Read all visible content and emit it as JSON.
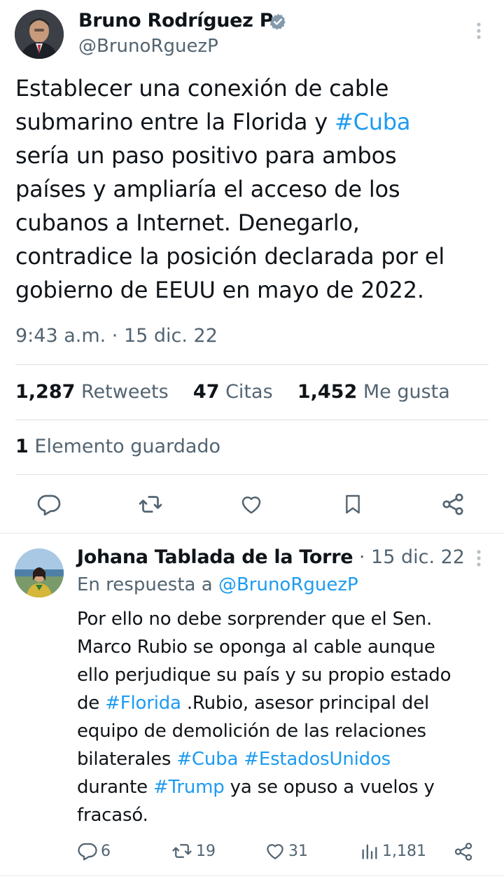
{
  "tweet": {
    "author_name": "Bruno Rodríguez P",
    "author_handle": "@BrunoRguezP",
    "verified_icon": "verified-badge-icon",
    "text_parts": [
      {
        "line": "Establecer una conexión de cable"
      },
      {
        "line_a": "submarino entre la Florida y ",
        "hashtag": "#Cuba"
      },
      {
        "line": "sería un paso positivo para ambos"
      },
      {
        "line": "países y ampliaría el acceso de los"
      },
      {
        "line": "cubanos a Internet. Denegarlo,"
      },
      {
        "line": "contradice la posición declarada por el"
      },
      {
        "line": "gobierno de EEUU en mayo de 2022."
      }
    ],
    "timestamp": "9:43 a.m. · 15 dic. 22",
    "retweets_count": "1,287",
    "retweets_label": "Retweets",
    "quotes_count": "47",
    "quotes_label": "Citas",
    "likes_count": "1,452",
    "likes_label": "Me gusta",
    "bookmarks_count": "1",
    "bookmarks_label": "Elemento guardado"
  },
  "reply": {
    "author_name": "Johana Tablada de la Torre",
    "sep": "·",
    "date": "15 dic. 22",
    "in_reply_prefix": "En respuesta a ",
    "in_reply_handle": "@BrunoRguezP",
    "lines": [
      "Por ello no debe sorprender que el Sen.",
      "Marco Rubio se oponga al cable aunque",
      "ello perjudique su país y su propio estado"
    ],
    "line4_a": "de ",
    "line4_tag": "#Florida",
    "line4_b": " .Rubio, asesor principal del",
    "line5": "equipo de demolición de las relaciones",
    "line6_a": "bilaterales ",
    "line6_tag1": "#Cuba",
    "line6_sp": " ",
    "line6_tag2": "#EstadosUnidos",
    "line7_a": "durante ",
    "line7_tag": "#Trump",
    "line7_b": " ya se opuso a vuelos y",
    "line8": "fracasó.",
    "replies": "6",
    "retweets": "19",
    "likes": "31",
    "views": "1,181"
  },
  "colors": {
    "accent": "#1d9bf0",
    "secondary_text": "#536471",
    "primary_text": "#0f1419"
  }
}
